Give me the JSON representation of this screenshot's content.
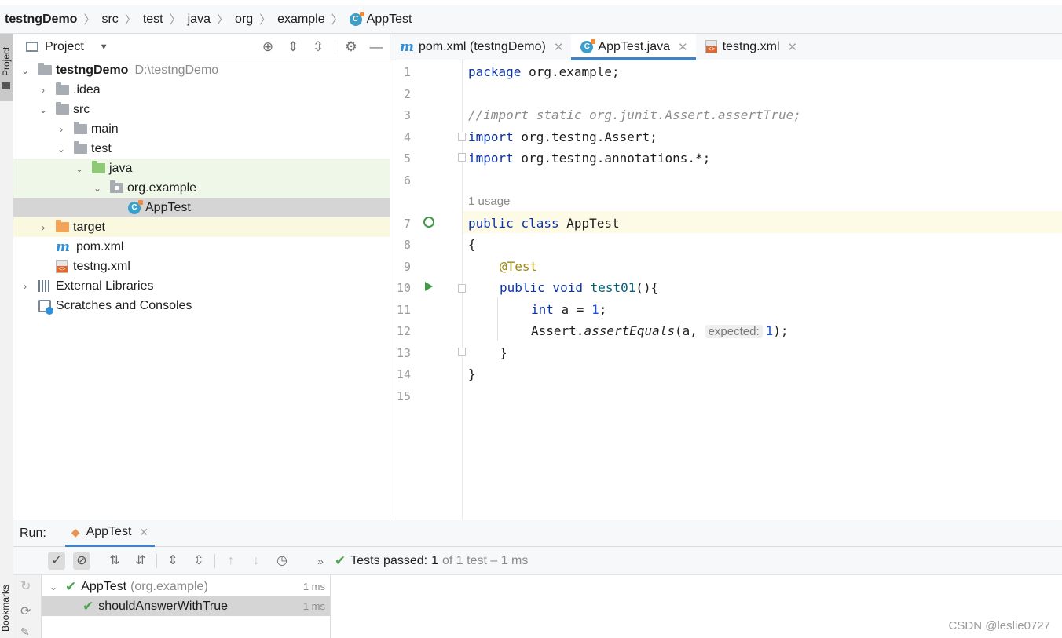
{
  "breadcrumb": {
    "items": [
      "testngDemo",
      "src",
      "test",
      "java",
      "org",
      "example",
      "AppTest"
    ]
  },
  "sidebar_tab": {
    "project": "Project",
    "bookmarks": "Bookmarks"
  },
  "project_panel": {
    "title": "Project",
    "root": {
      "name": "testngDemo",
      "path": "D:\\testngDemo"
    },
    "items": [
      {
        "label": ".idea"
      },
      {
        "label": "src"
      },
      {
        "label": "main"
      },
      {
        "label": "test"
      },
      {
        "label": "java"
      },
      {
        "label": "org.example"
      },
      {
        "label": "AppTest"
      },
      {
        "label": "target"
      },
      {
        "label": "pom.xml"
      },
      {
        "label": "testng.xml"
      },
      {
        "label": "External Libraries"
      },
      {
        "label": "Scratches and Consoles"
      }
    ]
  },
  "editor": {
    "tabs": [
      {
        "label": "pom.xml (testngDemo)",
        "icon": "maven-icon"
      },
      {
        "label": "AppTest.java",
        "icon": "class-icon"
      },
      {
        "label": "testng.xml",
        "icon": "xml-icon"
      }
    ],
    "active_tab": "AppTest.java",
    "line_numbers": [
      "1",
      "2",
      "3",
      "4",
      "5",
      "6",
      "7",
      "8",
      "9",
      "10",
      "11",
      "12",
      "13",
      "14",
      "15"
    ],
    "usage_hint": "1 usage",
    "code": {
      "l1_kw": "package",
      "l1_rest": " org.example;",
      "l3": "//import static org.junit.Assert.assertTrue;",
      "l4_kw": "import",
      "l4_rest": " org.testng.Assert;",
      "l5_kw": "import",
      "l5_rest": " org.testng.annotations.*;",
      "l7_kw": "public class",
      "l7_rest": " AppTest",
      "l8": "{",
      "l9": "@Test",
      "l10_kw": "public void",
      "l10_fn": "test01",
      "l10_rest": "(){",
      "l11_kw": "int",
      "l11_mid": " a = ",
      "l11_num": "1",
      "l11_end": ";",
      "l12_a": "Assert.",
      "l12_method": "assertEquals",
      "l12_b": "(a, ",
      "l12_hint": "expected:",
      "l12_num": "1",
      "l12_end": ");",
      "l13": "}",
      "l14": "}"
    }
  },
  "run_panel": {
    "label": "Run:",
    "tab": "AppTest",
    "status_prefix": "Tests passed:",
    "status_count": "1",
    "status_suffix": "of 1 test – 1 ms",
    "tests": [
      {
        "name": "AppTest",
        "qualifier": "(org.example)",
        "time": "1 ms"
      },
      {
        "name": "shouldAnswerWithTrue",
        "time": "1 ms"
      }
    ]
  },
  "watermark": "CSDN @leslie0727",
  "colors": {
    "accent": "#4083c9",
    "pass": "#4ca34f",
    "keyword": "#0b33a8"
  }
}
